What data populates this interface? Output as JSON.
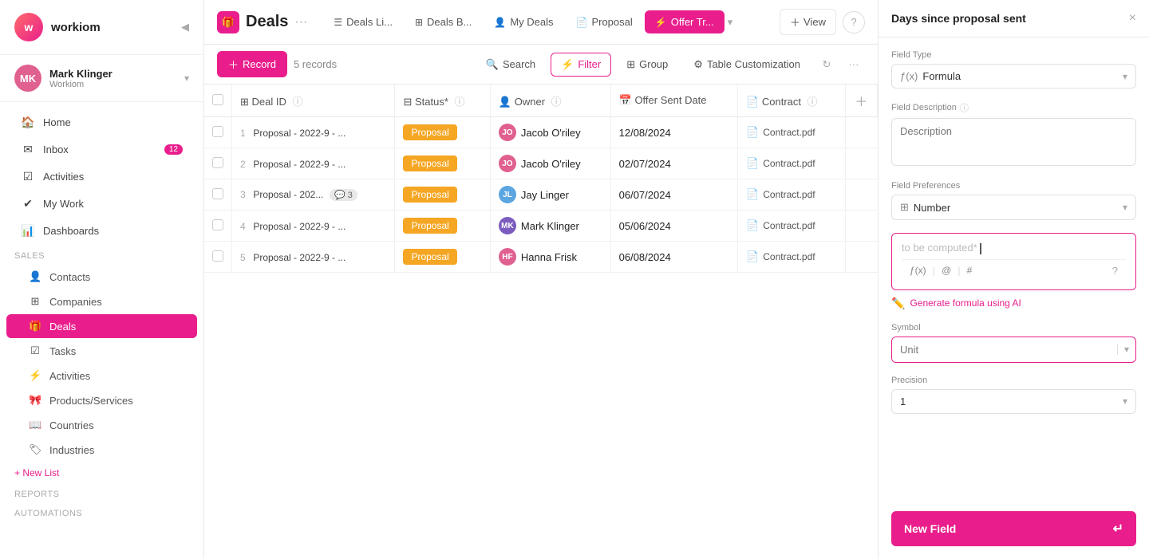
{
  "app": {
    "name": "workiom"
  },
  "sidebar": {
    "user": {
      "name": "Mark Klinger",
      "org": "Workiom",
      "initials": "MK"
    },
    "nav": [
      {
        "id": "home",
        "label": "Home",
        "icon": "🏠",
        "badge": null
      },
      {
        "id": "inbox",
        "label": "Inbox",
        "icon": "✉",
        "badge": "12"
      },
      {
        "id": "activities-top",
        "label": "Activities",
        "icon": "☑",
        "badge": null
      },
      {
        "id": "my-work",
        "label": "My Work",
        "icon": "✔",
        "badge": null
      },
      {
        "id": "dashboards",
        "label": "Dashboards",
        "icon": "📊",
        "badge": null
      }
    ],
    "sales_label": "Sales",
    "sales_items": [
      {
        "id": "contacts",
        "label": "Contacts",
        "icon": "👤"
      },
      {
        "id": "companies",
        "label": "Companies",
        "icon": "⊞"
      },
      {
        "id": "deals",
        "label": "Deals",
        "icon": "🎁",
        "active": true
      },
      {
        "id": "tasks",
        "label": "Tasks",
        "icon": "☑"
      },
      {
        "id": "activities",
        "label": "Activities",
        "icon": "⚡"
      },
      {
        "id": "products",
        "label": "Products/Services",
        "icon": "🎀"
      },
      {
        "id": "countries",
        "label": "Countries",
        "icon": "📖"
      },
      {
        "id": "industries",
        "label": "Industries",
        "icon": "🏷"
      }
    ],
    "new_list": "+ New List",
    "reports": "Reports",
    "automations": "Automations"
  },
  "topbar": {
    "page_icon": "🎁",
    "page_title": "Deals",
    "tabs": [
      {
        "id": "deals-list",
        "label": "Deals Li...",
        "icon": "☰",
        "active": false
      },
      {
        "id": "deals-board",
        "label": "Deals B...",
        "icon": "⊞",
        "active": false
      },
      {
        "id": "my-deals",
        "label": "My Deals",
        "icon": "👤",
        "active": false
      },
      {
        "id": "proposal",
        "label": "Proposal",
        "icon": "📄",
        "active": false
      },
      {
        "id": "offer-tracker",
        "label": "Offer Tr...",
        "icon": "⚡",
        "active": true
      }
    ],
    "view_label": "View",
    "help_icon": "?"
  },
  "toolbar": {
    "record_label": "Record",
    "records_count": "5 records",
    "search_label": "Search",
    "filter_label": "Filter",
    "group_label": "Group",
    "table_customization_label": "Table Customization"
  },
  "table": {
    "columns": [
      "Deal ID",
      "Status*",
      "Owner",
      "Offer Sent Date",
      "Contract"
    ],
    "rows": [
      {
        "num": 1,
        "deal_id": "Proposal - 2022-9 - ...",
        "status": "Proposal",
        "owner": "Jacob O'riley",
        "owner_color": "#e06090",
        "date": "12/08/2024",
        "contract": "Contract.pdf",
        "comments": null
      },
      {
        "num": 2,
        "deal_id": "Proposal - 2022-9 - ...",
        "status": "Proposal",
        "owner": "Jacob O'riley",
        "owner_color": "#e06090",
        "date": "02/07/2024",
        "contract": "Contract.pdf",
        "comments": null
      },
      {
        "num": 3,
        "deal_id": "Proposal - 202...",
        "status": "Proposal",
        "owner": "Jay Linger",
        "owner_color": "#5ba5e0",
        "date": "06/07/2024",
        "contract": "Contract.pdf",
        "comments": "3"
      },
      {
        "num": 4,
        "deal_id": "Proposal - 2022-9 - ...",
        "status": "Proposal",
        "owner": "Mark Klinger",
        "owner_color": "#7c5cbf",
        "date": "05/06/2024",
        "contract": "Contract.pdf",
        "comments": null
      },
      {
        "num": 5,
        "deal_id": "Proposal - 2022-9 - ...",
        "status": "Proposal",
        "owner": "Hanna Frisk",
        "owner_color": "#e06090",
        "date": "06/08/2024",
        "contract": "Contract.pdf",
        "comments": null
      }
    ]
  },
  "panel": {
    "title": "Days since proposal sent",
    "close_icon": "×",
    "field_type_label": "Field Type",
    "field_type_icon": "ƒ(x)",
    "field_type_value": "Formula",
    "field_desc_label": "Field Description",
    "field_desc_placeholder": "Description",
    "field_pref_label": "Field Preferences",
    "field_pref_icon": "⊞",
    "field_pref_value": "Number",
    "formula_placeholder": "to be computed*",
    "formula_toolbar": {
      "fx": "ƒ(x)",
      "at": "@",
      "hash": "#"
    },
    "ai_label": "Generate formula using AI",
    "symbol_label": "Symbol",
    "unit_placeholder": "Unit",
    "precision_label": "Precision",
    "precision_value": "1",
    "new_field_label": "New Field"
  }
}
